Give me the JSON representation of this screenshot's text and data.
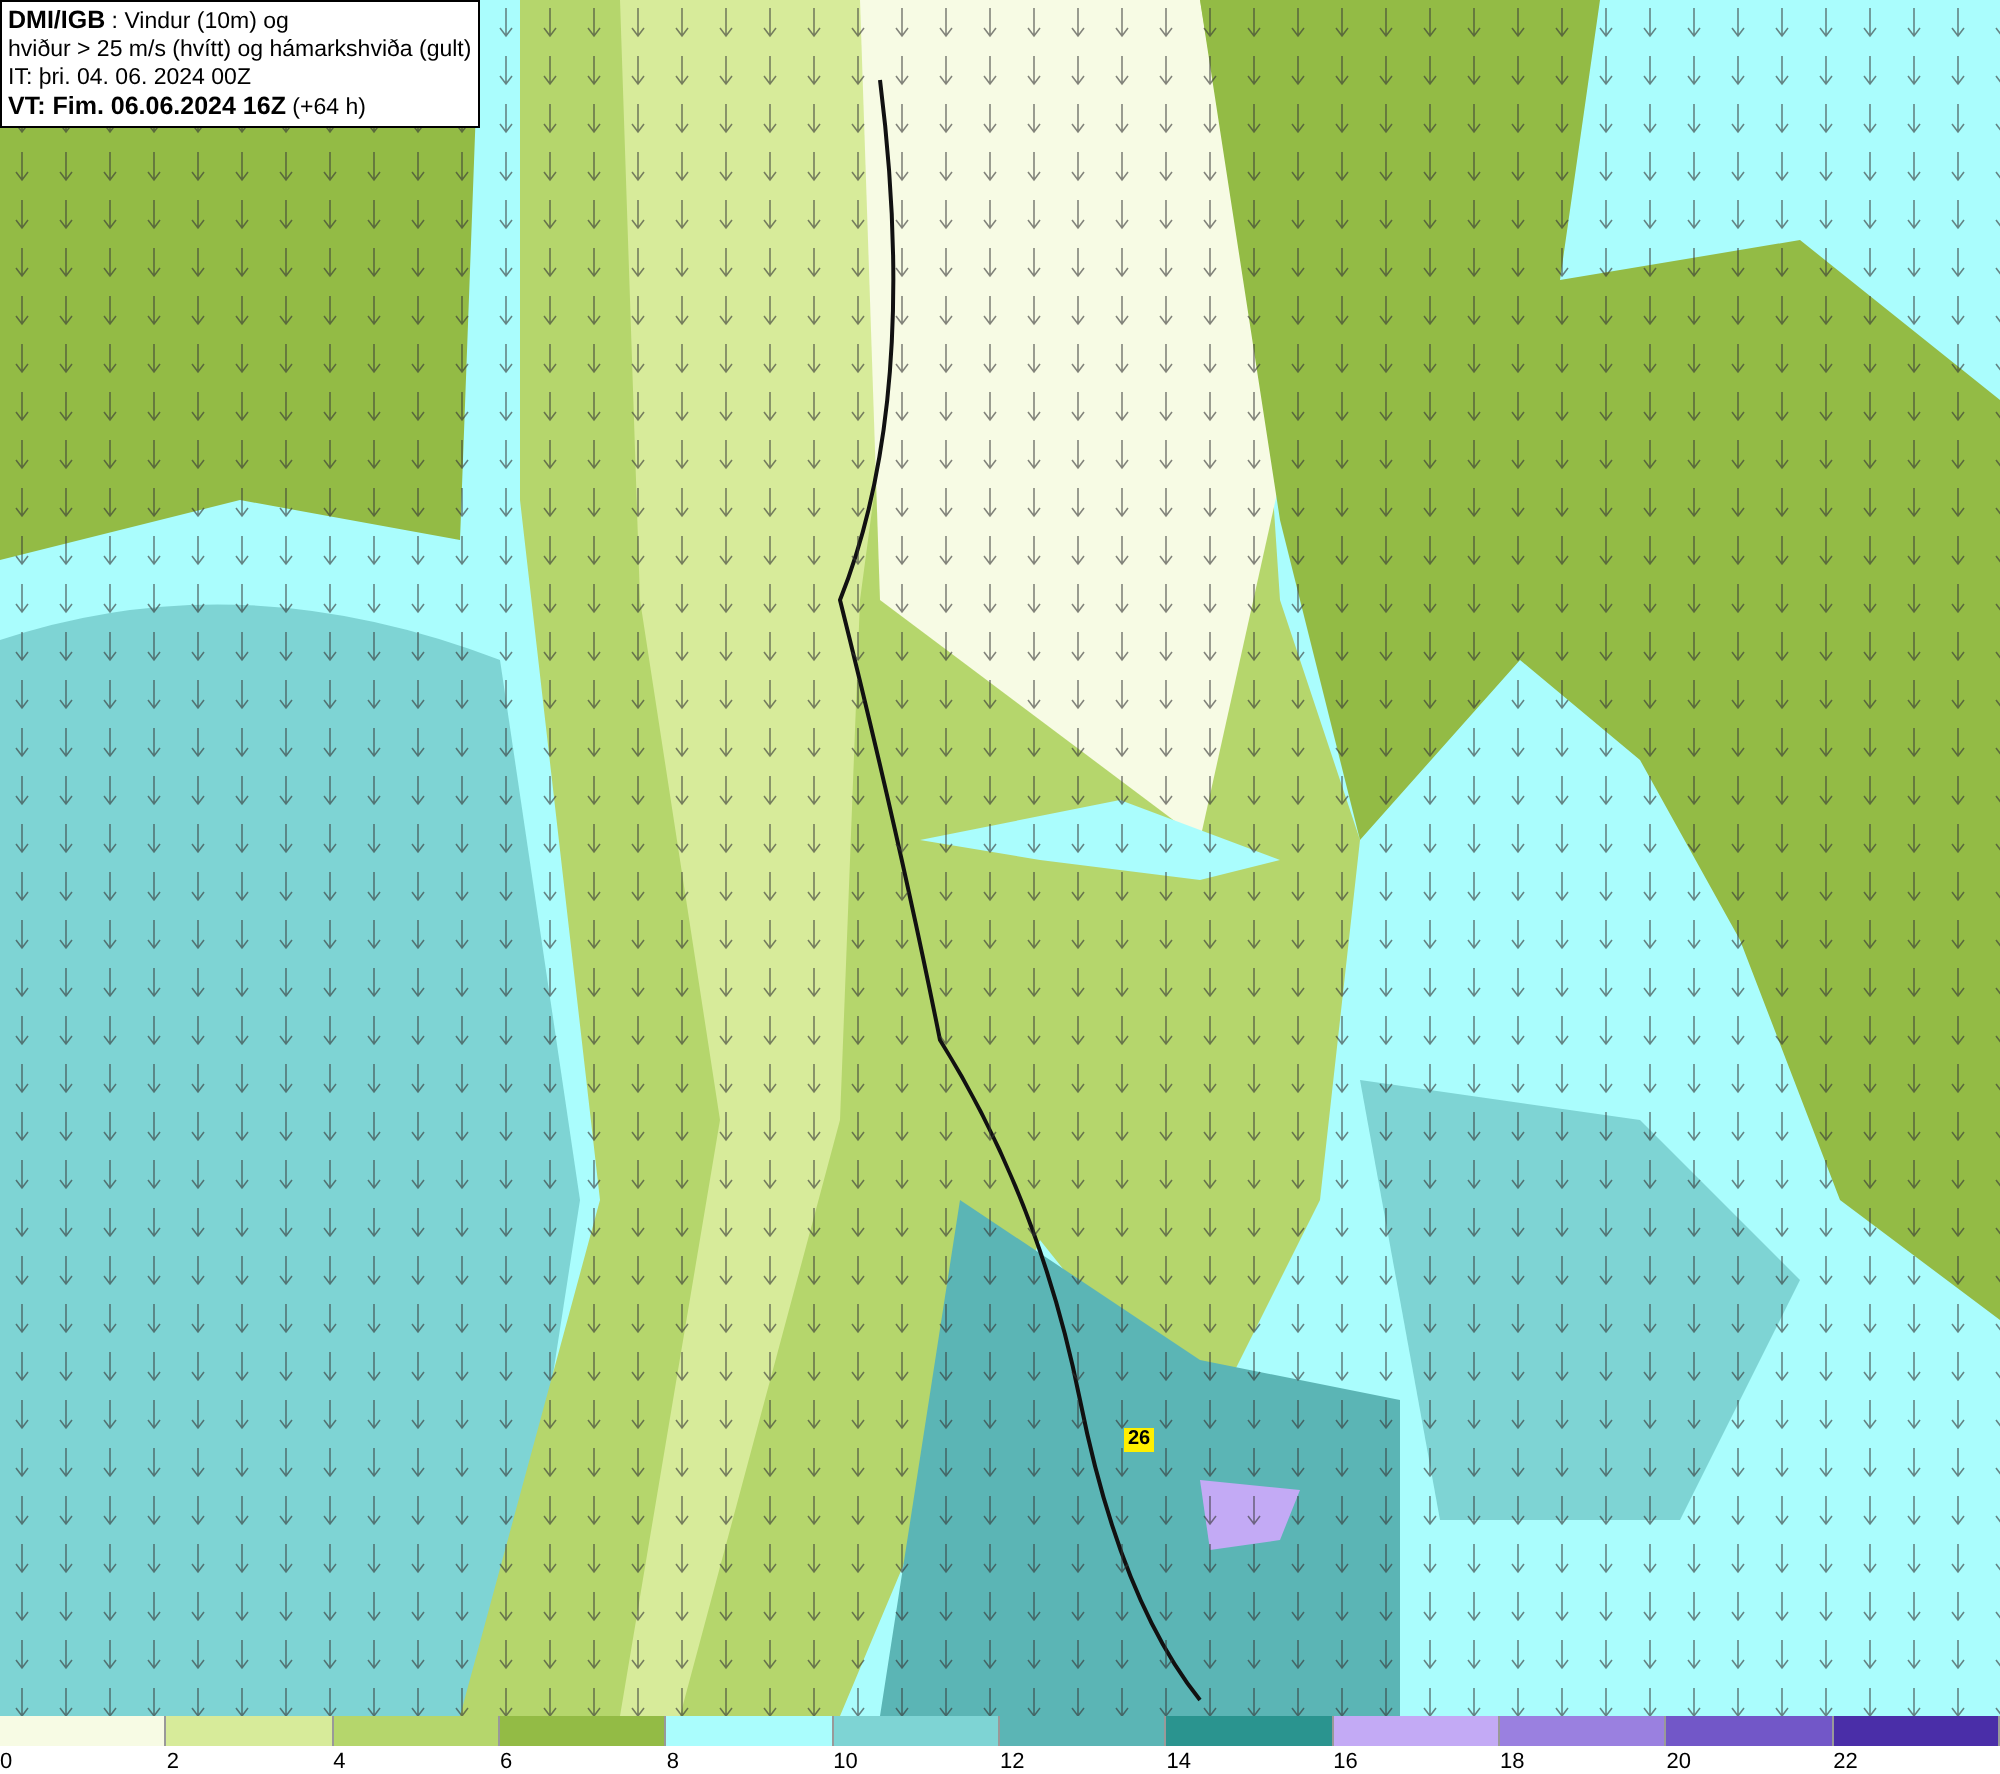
{
  "title_box": {
    "lines": [
      "**DMI/IGB** : Vindur (10m) og",
      "hviður > 25 m/s (hvítt) og hámarkshviða (gult)",
      "IT: þri. 04. 06. 2024 00Z",
      "**VT: Fim. 06.06.2024 16Z** (+64 h)"
    ]
  },
  "gust_marker": {
    "label": "26"
  },
  "legend": {
    "bins": [
      {
        "color": "#f7fbe4",
        "label": "0"
      },
      {
        "color": "#d7eb9a",
        "label": "2"
      },
      {
        "color": "#b5d66c",
        "label": "4"
      },
      {
        "color": "#93bb45",
        "label": "6"
      },
      {
        "color": "#aafdfd",
        "label": "8"
      },
      {
        "color": "#7ed4d4",
        "label": "10"
      },
      {
        "color": "#5bb5b5",
        "label": "12"
      },
      {
        "color": "#2a948f",
        "label": "14"
      },
      {
        "color": "#c3aaf5",
        "label": "16"
      },
      {
        "color": "#9a80e0",
        "label": "18"
      },
      {
        "color": "#7257c8",
        "label": "20"
      },
      {
        "color": "#4a2ea8",
        "label": "22"
      }
    ]
  }
}
